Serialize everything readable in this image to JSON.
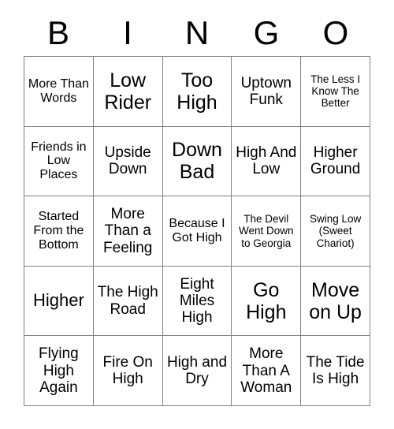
{
  "card": {
    "header": {
      "letters": [
        "B",
        "I",
        "N",
        "G",
        "O"
      ]
    },
    "rows": [
      {
        "cells": [
          {
            "text": "More Than Words",
            "size": "sm"
          },
          {
            "text": "Low Rider",
            "size": "xl"
          },
          {
            "text": "Too High",
            "size": "xl"
          },
          {
            "text": "Uptown Funk",
            "size": "md"
          },
          {
            "text": "The Less I Know The Better",
            "size": "xs"
          }
        ]
      },
      {
        "cells": [
          {
            "text": "Friends in Low Places",
            "size": "sm"
          },
          {
            "text": "Upside Down",
            "size": "md"
          },
          {
            "text": "Down Bad",
            "size": "xl"
          },
          {
            "text": "High And Low",
            "size": "md"
          },
          {
            "text": "Higher Ground",
            "size": "md"
          }
        ]
      },
      {
        "cells": [
          {
            "text": "Started From the Bottom",
            "size": "sm"
          },
          {
            "text": "More Than a Feeling",
            "size": "md"
          },
          {
            "text": "Because I Got High",
            "size": "sm"
          },
          {
            "text": "The Devil Went Down to Georgia",
            "size": "xs"
          },
          {
            "text": "Swing Low (Sweet Chariot)",
            "size": "xs"
          }
        ]
      },
      {
        "cells": [
          {
            "text": "Higher",
            "size": "lg"
          },
          {
            "text": "The High Road",
            "size": "md"
          },
          {
            "text": "Eight Miles High",
            "size": "md"
          },
          {
            "text": "Go High",
            "size": "xl"
          },
          {
            "text": "Move on Up",
            "size": "xl"
          }
        ]
      },
      {
        "cells": [
          {
            "text": "Flying High Again",
            "size": "md"
          },
          {
            "text": "Fire On High",
            "size": "md"
          },
          {
            "text": "High and Dry",
            "size": "md"
          },
          {
            "text": "More Than A Woman",
            "size": "md"
          },
          {
            "text": "The Tide Is High",
            "size": "md"
          }
        ]
      }
    ]
  },
  "colors": {
    "background": "#ffffff",
    "text": "#000000",
    "grid_line": "#808080"
  }
}
